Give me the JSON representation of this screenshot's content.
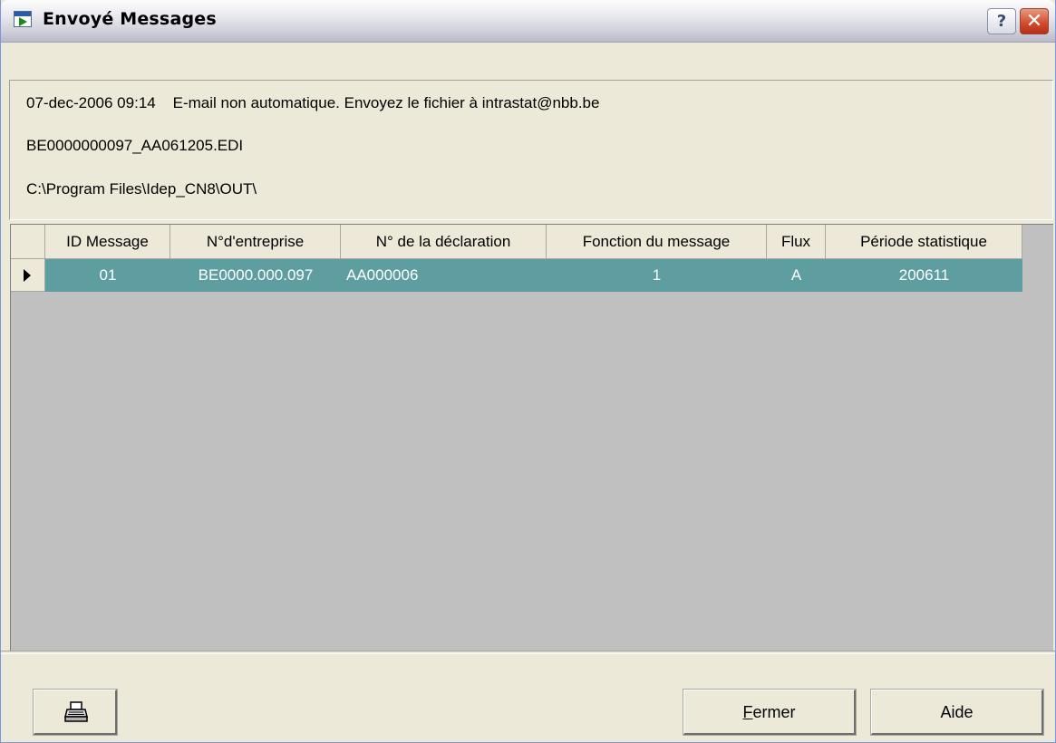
{
  "window": {
    "title": "Envoyé Messages",
    "help_button": "?",
    "close_button": "✕"
  },
  "info": {
    "line1": "07-dec-2006 09:14    E-mail non automatique. Envoyez le fichier à intrastat@nbb.be",
    "line2": "BE0000000097_AA061205.EDI",
    "line3": "C:\\Program Files\\Idep_CN8\\OUT\\"
  },
  "grid": {
    "columns": [
      "ID Message",
      "N°d'entreprise",
      "N° de la déclaration",
      "Fonction du message",
      "Flux",
      "Période statistique"
    ],
    "rows": [
      {
        "id_message": "01",
        "entreprise": "BE0000.000.097",
        "declaration": "AA000006",
        "fonction": "1",
        "flux": "A",
        "periode": "200611"
      }
    ]
  },
  "buttons": {
    "print_icon": "printer-icon",
    "fermer_mnemonic": "F",
    "fermer_rest": "ermer",
    "aide": "Aide"
  },
  "colors": {
    "selected_row": "#5f9ea0",
    "grid_background": "#c0c0c0",
    "dialog_background": "#ece9d8"
  }
}
